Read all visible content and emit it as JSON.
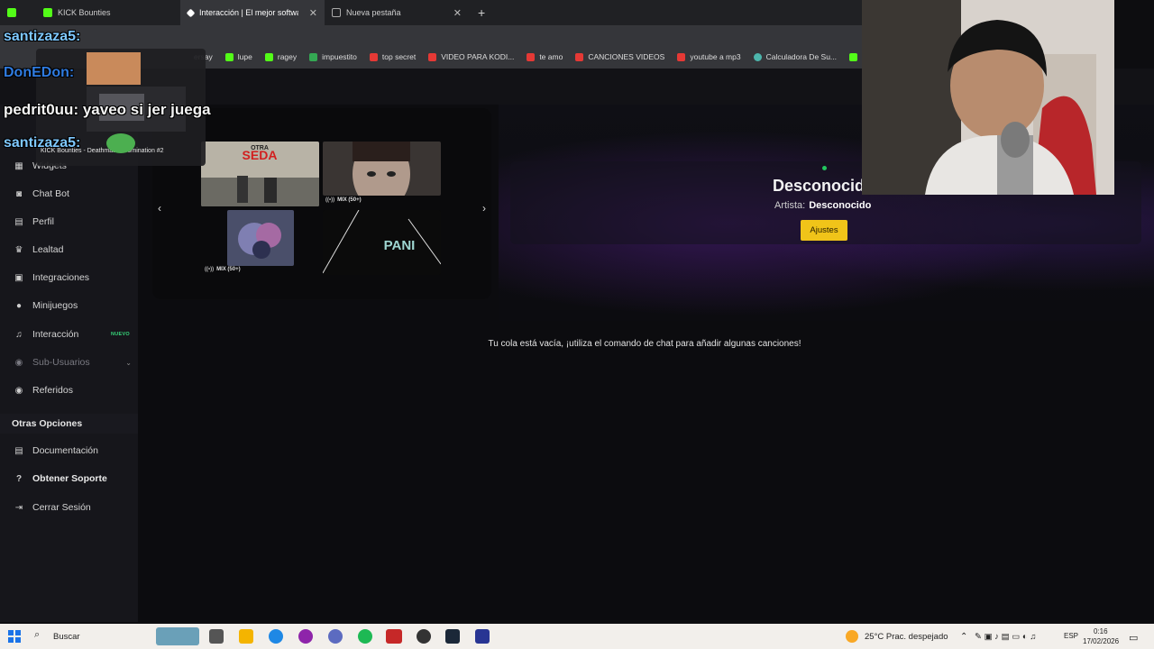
{
  "browser": {
    "tabs": [
      {
        "label": "KICK Bounties",
        "color": "#53fc18"
      },
      {
        "label": "Interacción | El mejor software par",
        "color": "#ffffff"
      },
      {
        "label": "Nueva pestaña",
        "color": "#9aa0a6"
      }
    ],
    "bookmarks": [
      {
        "label": "ersay",
        "color": "#888888"
      },
      {
        "label": "lupe",
        "color": "#53fc18"
      },
      {
        "label": "ragey",
        "color": "#53fc18"
      },
      {
        "label": "impuestito",
        "color": "#34a853"
      },
      {
        "label": "top secret",
        "color": "#e53935"
      },
      {
        "label": "VIDEO PARA KODI...",
        "color": "#e53935"
      },
      {
        "label": "te amo",
        "color": "#e53935"
      },
      {
        "label": "CANCIONES VIDEOS",
        "color": "#e53935"
      },
      {
        "label": "youtube a mp3",
        "color": "#e53935"
      },
      {
        "label": "Calculadora De Su...",
        "color": "#4db6ac"
      },
      {
        "label": "Ki",
        "color": "#53fc18"
      }
    ]
  },
  "chat_overlay": {
    "lines": [
      {
        "user": "santizaza5:",
        "text": ""
      },
      {
        "user": "DonEDon:",
        "text": ""
      },
      {
        "user": "pedrit0uu:",
        "text": "yaveo si jer juega"
      },
      {
        "user": "santizaza5:",
        "text": ""
      }
    ],
    "preview_title": "KICK Bounties - Deathmatch Domination #2"
  },
  "sidebar": {
    "items": [
      {
        "label": "Widgets",
        "icon": "widgets-icon"
      },
      {
        "label": "Chat Bot",
        "icon": "robot-icon"
      },
      {
        "label": "Perfil",
        "icon": "profile-card-icon"
      },
      {
        "label": "Lealtad",
        "icon": "trophy-icon"
      },
      {
        "label": "Integraciones",
        "icon": "integrations-icon"
      },
      {
        "label": "Minijuegos",
        "icon": "gamepad-icon"
      },
      {
        "label": "Interacción",
        "icon": "music-note-icon",
        "badge": "NUEVO"
      },
      {
        "label": "Sub-Usuarios",
        "icon": "users-icon"
      },
      {
        "label": "Referidos",
        "icon": "referrals-icon"
      }
    ],
    "other_section": "Otras Opciones",
    "other_items": [
      {
        "label": "Documentación",
        "icon": "document-icon"
      },
      {
        "label": "Obtener Soporte",
        "icon": "help-icon"
      },
      {
        "label": "Cerrar Sesión",
        "icon": "logout-icon"
      }
    ]
  },
  "carousel": {
    "thumbs": [
      {
        "label": "",
        "title_art": "OTRA SEDA"
      },
      {
        "label": "MIX (50+)"
      },
      {
        "label": "MIX (50+)"
      },
      {
        "label": "",
        "title_art": "PANI"
      }
    ]
  },
  "player": {
    "title": "Desconocido",
    "artist_label": "Artista:",
    "artist_value": "Desconocido",
    "settings_button": "Ajustes"
  },
  "queue": {
    "empty_message": "Tu cola está vacía, ¡utiliza el comando de chat para añadir algunas canciones!"
  },
  "taskbar": {
    "search_label": "Buscar",
    "weather": "25°C  Prac. despejado",
    "language": "ESP",
    "time": "0:16",
    "date": "17/02/2026"
  }
}
